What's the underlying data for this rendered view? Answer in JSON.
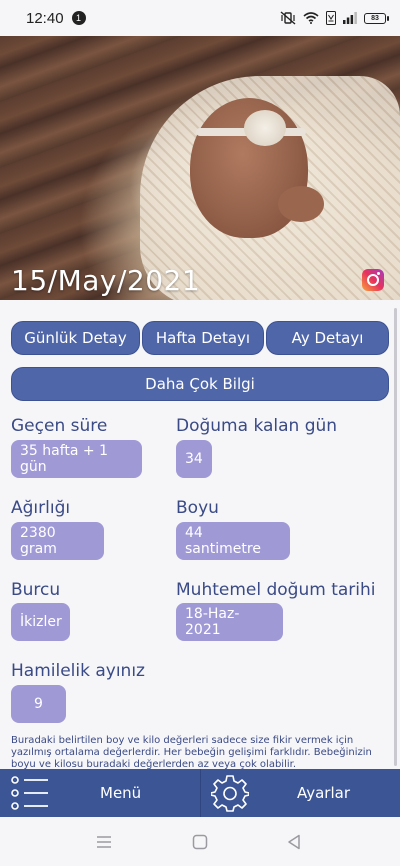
{
  "status_bar": {
    "time": "12:40",
    "notification_count": "1",
    "battery": "83"
  },
  "hero": {
    "date": "15/May/2021"
  },
  "tabs": [
    {
      "label": "Günlük Detay"
    },
    {
      "label": "Hafta Detayı"
    },
    {
      "label": "Ay Detayı"
    }
  ],
  "more_info_label": "Daha Çok Bilgi",
  "fields": {
    "elapsed": {
      "label": "Geçen süre",
      "value": "35 hafta + 1 gün"
    },
    "days_left": {
      "label": "Doğuma kalan gün",
      "value": "34"
    },
    "weight": {
      "label": "Ağırlığı",
      "value": "2380 gram"
    },
    "length": {
      "label": "Boyu",
      "value": "44 santimetre"
    },
    "zodiac": {
      "label": "Burcu",
      "value": "İkizler"
    },
    "due_date": {
      "label": "Muhtemel doğum tarihi",
      "value": "18-Haz-2021"
    },
    "month": {
      "label": "Hamilelik ayınız",
      "value": "9"
    }
  },
  "disclaimer": "Buradaki belirtilen boy ve kilo değerleri sadece size fikir vermek için yazılmış ortalama değerlerdir. Her bebeğin gelişimi farklıdır. Bebeğinizin boyu ve kilosu buradaki değerlerden az veya çok olabilir.",
  "bottom_bar": {
    "menu_label": "Menü",
    "settings_label": "Ayarlar"
  },
  "colors": {
    "button": "#4f66a8",
    "pill": "#9f99d6",
    "app_bar": "#3c5595",
    "text": "#3a4a86"
  }
}
